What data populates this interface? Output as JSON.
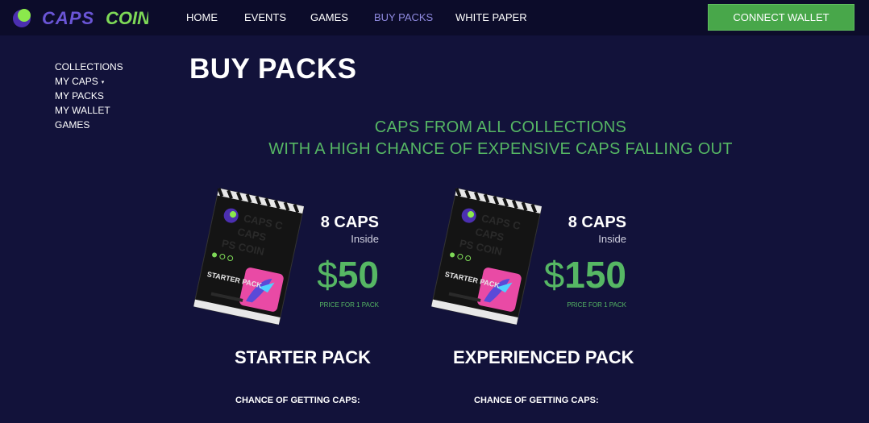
{
  "brand": {
    "name": "CAPS COIN",
    "part1": "CAPS",
    "part2": "COIN",
    "colors": {
      "ball": "#8be94c",
      "caps": "#6a55d6",
      "coin": "#7ed957"
    }
  },
  "nav": {
    "items": [
      "HOME",
      "EVENTS",
      "GAMES",
      "BUY PACKS",
      "WHITE PAPER"
    ],
    "active": "BUY PACKS"
  },
  "header": {
    "connect_label": "CONNECT WALLET"
  },
  "sidebar": {
    "items": [
      "COLLECTIONS",
      "MY CAPS",
      "MY PACKS",
      "MY WALLET",
      "GAMES"
    ],
    "dropdown_indicator": "▾"
  },
  "main": {
    "title": "BUY PACKS",
    "subtitle_line1": "CAPS FROM ALL COLLECTIONS",
    "subtitle_line2": "WITH A HIGH CHANCE OF EXPENSIVE CAPS FALLING OUT"
  },
  "packs": [
    {
      "count": "8 CAPS",
      "inside": "Inside",
      "currency": "$",
      "price": "50",
      "price_note": "PRICE FOR 1 PACK",
      "name": "STARTER PACK",
      "chance_label": "CHANCE OF GETTING CAPS:",
      "pack_label": "STARTER PACK"
    },
    {
      "count": "8 CAPS",
      "inside": "Inside",
      "currency": "$",
      "price": "150",
      "price_note": "PRICE FOR 1 PACK",
      "name": "EXPERIENCED PACK",
      "chance_label": "CHANCE OF GETTING CAPS:",
      "pack_label": "STARTER PACK"
    }
  ],
  "colors": {
    "background": "#12123a",
    "topbar": "#0c0c2a",
    "accent_green": "#56b764",
    "button_green": "#48a74a",
    "active_nav": "#8f8ae0"
  }
}
